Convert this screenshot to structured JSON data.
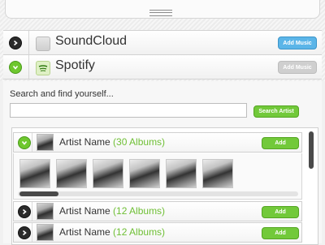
{
  "services": [
    {
      "name": "SoundCloud",
      "action_label": "Add Music",
      "expanded": false,
      "action_enabled": true
    },
    {
      "name": "Spotify",
      "action_label": "Add Music",
      "expanded": true,
      "action_enabled": false
    }
  ],
  "search": {
    "label": "Search and find yourself...",
    "value": "",
    "placeholder": "",
    "button_label": "Search Artist"
  },
  "results": [
    {
      "name": "Artist Name",
      "albums": "(30 Albums)",
      "add_label": "Add",
      "expanded": true
    },
    {
      "name": "Artist Name",
      "albums": "(12 Albums)",
      "add_label": "Add",
      "expanded": false
    },
    {
      "name": "Artist Name",
      "albums": "(12 Albums)",
      "add_label": "Add",
      "expanded": false
    }
  ],
  "colors": {
    "accent_green": "#72c93a",
    "accent_blue": "#5bb5e8",
    "count_text": "#6fbf35"
  }
}
